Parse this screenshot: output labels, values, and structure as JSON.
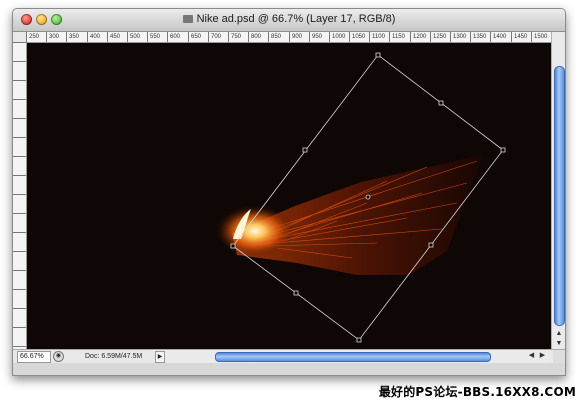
{
  "window": {
    "title": "Nike ad.psd @ 66.7% (Layer 17, RGB/8)"
  },
  "ruler": {
    "top_ticks": [
      "250",
      "300",
      "350",
      "400",
      "450",
      "500",
      "550",
      "600",
      "650",
      "700",
      "750",
      "800",
      "850",
      "900",
      "950",
      "1000",
      "1050",
      "1100",
      "1150",
      "1200",
      "1250",
      "1300",
      "1350",
      "1400",
      "1450",
      "1500"
    ]
  },
  "status": {
    "zoom": "66.67%",
    "doc": "Doc: 6.59M/47.5M"
  },
  "watermark": "最好的PS论坛-BBS.16XX8.COM",
  "icons": {
    "navigator": "navigator-icon",
    "status_menu": "triangle-right-icon"
  },
  "colors": {
    "canvas_bg": "#0e0705",
    "fire_core": "#fff4d6",
    "fire_mid": "#ff7a12",
    "transform_box": "#d8d8d8",
    "scroll_accent": "#5a8fdc"
  }
}
